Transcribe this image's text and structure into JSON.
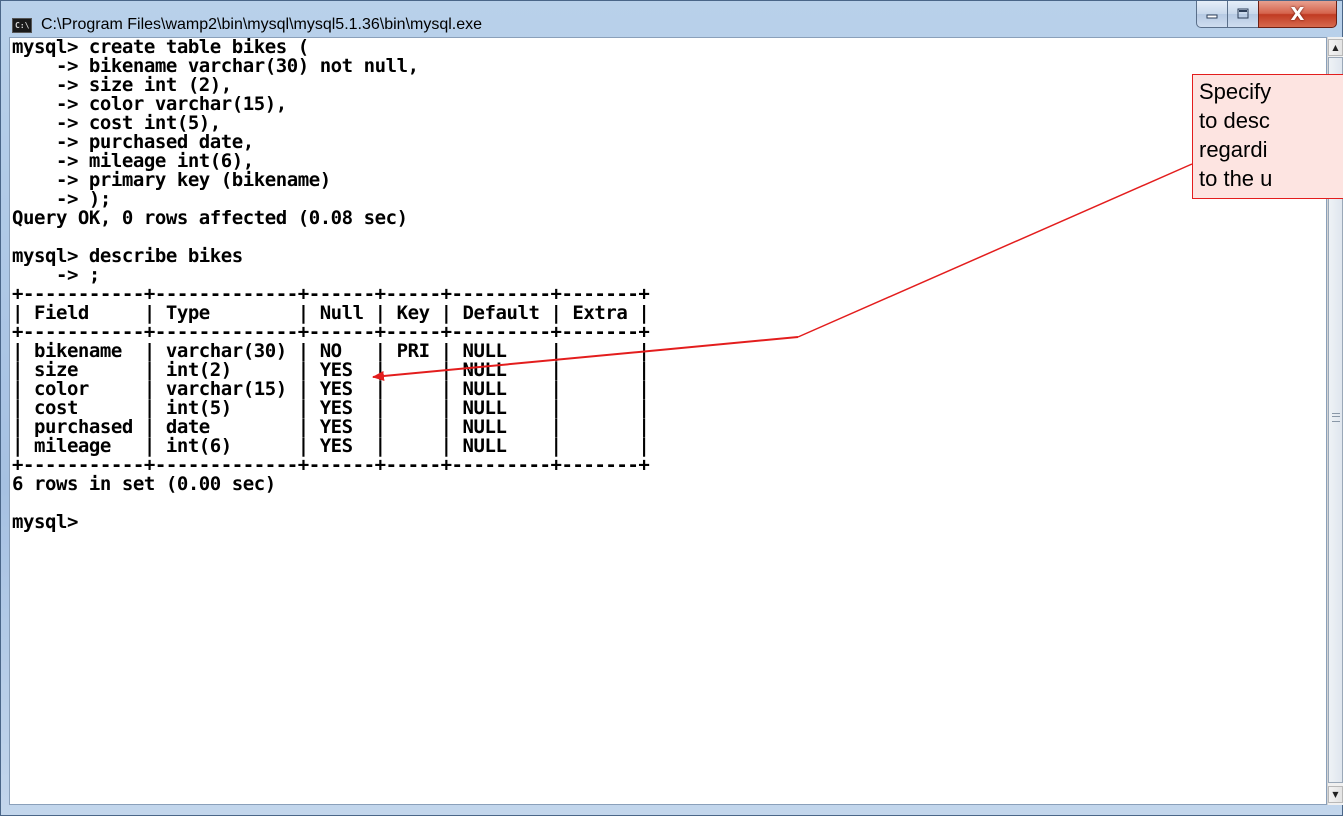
{
  "window": {
    "title": "C:\\Program Files\\wamp2\\bin\\mysql\\mysql5.1.36\\bin\\mysql.exe",
    "icon_text": "C:\\",
    "buttons": {
      "minimize_icon": "minimize-icon",
      "maximize_icon": "maximize-icon",
      "close_label": "X"
    }
  },
  "console": {
    "lines": [
      "mysql> create table bikes (",
      "    -> bikename varchar(30) not null,",
      "    -> size int (2),",
      "    -> color varchar(15),",
      "    -> cost int(5),",
      "    -> purchased date,",
      "    -> mileage int(6),",
      "    -> primary key (bikename)",
      "    -> );",
      "Query OK, 0 rows affected (0.08 sec)",
      "",
      "mysql> describe bikes",
      "    -> ;",
      "+-----------+-------------+------+-----+---------+-------+",
      "| Field     | Type        | Null | Key | Default | Extra |",
      "+-----------+-------------+------+-----+---------+-------+",
      "| bikename  | varchar(30) | NO   | PRI | NULL    |       |",
      "| size      | int(2)      | YES  |     | NULL    |       |",
      "| color     | varchar(15) | YES  |     | NULL    |       |",
      "| cost      | int(5)      | YES  |     | NULL    |       |",
      "| purchased | date        | YES  |     | NULL    |       |",
      "| mileage   | int(6)      | YES  |     | NULL    |       |",
      "+-----------+-------------+------+-----+---------+-------+",
      "6 rows in set (0.00 sec)",
      "",
      "mysql>"
    ]
  },
  "callout": {
    "lines": [
      "Specify",
      "to desc",
      "regardi",
      "to the u"
    ]
  },
  "colors": {
    "callout_border": "#e31d1d",
    "callout_fill": "#fde4e1",
    "arrow": "#e31d1d"
  }
}
